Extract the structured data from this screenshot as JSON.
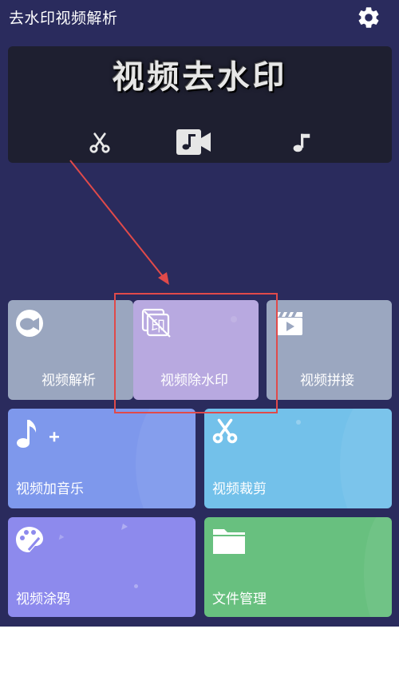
{
  "header": {
    "title": "去水印视频解析",
    "settings_icon": "gear-icon"
  },
  "banner": {
    "title": "视频去水印",
    "icons": [
      "scissors-icon",
      "video-music-icon",
      "music-note-icon"
    ]
  },
  "tiles": [
    {
      "label": "视频解析",
      "icon": "camera-lens-icon",
      "color": "#9aa6bf"
    },
    {
      "label": "视频除水印",
      "icon": "watermark-remove-icon",
      "color": "#b8a9e0"
    },
    {
      "label": "视频拼接",
      "icon": "clapperboard-icon",
      "color": "#9ba7c0"
    },
    {
      "label": "视频加音乐",
      "icon": "music-plus-icon",
      "color": "#7e98ec"
    },
    {
      "label": "视频裁剪",
      "icon": "scissors-icon",
      "color": "#73c1ea"
    },
    {
      "label": "视频涂鸦",
      "icon": "palette-icon",
      "color": "#8d8aed"
    },
    {
      "label": "文件管理",
      "icon": "folder-icon",
      "color": "#68c07f"
    }
  ],
  "overlay": {
    "highlight_color": "#e04a4a"
  },
  "watermark_char": "印"
}
